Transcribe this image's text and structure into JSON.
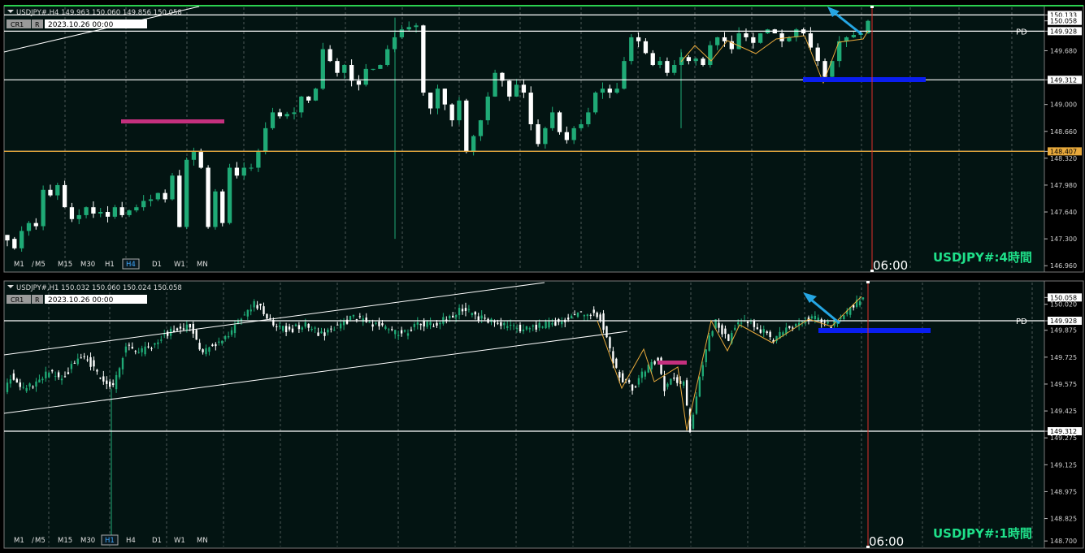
{
  "colors": {
    "bg": "#031412",
    "bull": "#1faa76",
    "bear": "#ffffff",
    "level": "#ffffff",
    "orange": "#e8a93c",
    "blue": "#0a1ef0",
    "pink": "#c4307e",
    "cyan": "#25a6e3",
    "vline": "#e0302a",
    "label": "#1fe08a"
  },
  "timeframes_top": [
    "M1",
    "M5",
    "M15",
    "M30",
    "H1",
    "H4",
    "D1",
    "W1",
    "MN"
  ],
  "timeframes_bottom": [
    "M1",
    "M5",
    "M15",
    "M30",
    "H1",
    "H4",
    "D1",
    "W1",
    "MN"
  ],
  "chart_data": [
    {
      "type": "candlestick",
      "symbol_line": "USDJPY#,H4  149.963 150.060 149.856 150.058",
      "badge_cr": "CR1",
      "badge_r": "R",
      "date": "2023.10.26 00:00",
      "watermark": "USDJPY#:4時間",
      "time_label": "06:00",
      "pd_label": "PD",
      "active_tf": "H4",
      "ylim": [
        146.88,
        150.25
      ],
      "yticks": [
        "150.133",
        "150.058",
        "149.928",
        "149.680",
        "149.312",
        "149.000",
        "148.660",
        "148.407",
        "148.320",
        "147.980",
        "147.640",
        "147.300",
        "146.960"
      ],
      "levels": [
        149.928,
        149.312,
        150.133,
        148.407
      ],
      "level_tags": [
        {
          "value": "150.133",
          "color": "white"
        },
        {
          "value": "150.058",
          "color": "white"
        },
        {
          "value": "149.928",
          "color": "white"
        },
        {
          "value": "149.312",
          "color": "white"
        },
        {
          "value": "148.407",
          "color": "orange"
        }
      ],
      "close_start": 147.28,
      "close_end": 150.058,
      "ohlc": [
        [
          147.35,
          147.28
        ],
        [
          147.3,
          147.18
        ],
        [
          147.18,
          147.4
        ],
        [
          147.4,
          147.5
        ],
        [
          147.5,
          147.46
        ],
        [
          147.46,
          147.92
        ],
        [
          147.92,
          147.85
        ],
        [
          147.85,
          147.98
        ],
        [
          147.98,
          147.7
        ],
        [
          147.7,
          147.55
        ],
        [
          147.55,
          147.6
        ],
        [
          147.6,
          147.7
        ],
        [
          147.7,
          147.62
        ],
        [
          147.62,
          147.64
        ],
        [
          147.64,
          147.58
        ],
        [
          147.58,
          147.7
        ],
        [
          147.7,
          147.6
        ],
        [
          147.6,
          147.66
        ],
        [
          147.66,
          147.7
        ],
        [
          147.7,
          147.78
        ],
        [
          147.78,
          147.8
        ],
        [
          147.8,
          147.88
        ],
        [
          147.88,
          147.8
        ],
        [
          147.8,
          148.1
        ],
        [
          148.1,
          147.45
        ],
        [
          147.45,
          148.3
        ],
        [
          148.3,
          148.4
        ],
        [
          148.4,
          148.2
        ],
        [
          148.2,
          147.45
        ],
        [
          147.45,
          147.9
        ],
        [
          147.9,
          147.5
        ],
        [
          147.5,
          148.2
        ],
        [
          148.2,
          148.1
        ],
        [
          148.1,
          148.2
        ],
        [
          148.2,
          148.2
        ],
        [
          148.2,
          148.4
        ],
        [
          148.4,
          148.7
        ],
        [
          148.7,
          148.9
        ],
        [
          148.9,
          148.85
        ],
        [
          148.85,
          148.88
        ],
        [
          148.88,
          148.9
        ],
        [
          148.9,
          149.1
        ],
        [
          149.1,
          149.05
        ],
        [
          149.05,
          149.2
        ],
        [
          149.2,
          149.7
        ],
        [
          149.7,
          149.55
        ],
        [
          149.55,
          149.4
        ],
        [
          149.4,
          149.5
        ],
        [
          149.5,
          149.3
        ],
        [
          149.3,
          149.25
        ],
        [
          149.25,
          149.45
        ],
        [
          149.45,
          149.45
        ],
        [
          149.45,
          149.5
        ],
        [
          149.5,
          149.7
        ],
        [
          149.7,
          149.85
        ],
        [
          149.85,
          149.95
        ],
        [
          149.95,
          149.98
        ],
        [
          149.98,
          150.0
        ],
        [
          150.0,
          149.15
        ],
        [
          149.15,
          148.95
        ],
        [
          148.95,
          149.2
        ],
        [
          149.2,
          149.0
        ],
        [
          149.0,
          148.8
        ],
        [
          148.8,
          149.05
        ],
        [
          149.05,
          148.4
        ],
        [
          148.4,
          148.6
        ],
        [
          148.6,
          148.8
        ],
        [
          148.8,
          149.1
        ],
        [
          149.1,
          149.4
        ],
        [
          149.4,
          149.3
        ],
        [
          149.3,
          149.1
        ],
        [
          149.1,
          149.25
        ],
        [
          149.25,
          149.15
        ],
        [
          149.15,
          148.75
        ],
        [
          148.75,
          148.5
        ],
        [
          148.5,
          148.7
        ],
        [
          148.7,
          148.9
        ],
        [
          148.9,
          148.65
        ],
        [
          148.65,
          148.55
        ],
        [
          148.55,
          148.7
        ],
        [
          148.7,
          148.75
        ],
        [
          148.75,
          148.9
        ],
        [
          148.9,
          149.15
        ],
        [
          149.15,
          149.2
        ],
        [
          149.2,
          149.15
        ],
        [
          149.15,
          149.2
        ],
        [
          149.2,
          149.55
        ],
        [
          149.55,
          149.85
        ],
        [
          149.85,
          149.8
        ],
        [
          149.8,
          149.65
        ],
        [
          149.65,
          149.5
        ],
        [
          149.5,
          149.55
        ],
        [
          149.55,
          149.4
        ],
        [
          149.4,
          149.5
        ],
        [
          149.5,
          149.6
        ],
        [
          149.6,
          149.55
        ],
        [
          149.55,
          149.58
        ],
        [
          149.58,
          149.5
        ],
        [
          149.5,
          149.75
        ],
        [
          149.75,
          149.85
        ],
        [
          149.85,
          149.8
        ],
        [
          149.8,
          149.7
        ],
        [
          149.7,
          149.9
        ],
        [
          149.9,
          149.85
        ],
        [
          149.85,
          149.78
        ],
        [
          149.78,
          149.9
        ],
        [
          149.9,
          149.95
        ],
        [
          149.95,
          149.9
        ],
        [
          149.9,
          149.8
        ],
        [
          149.8,
          149.85
        ],
        [
          149.85,
          149.95
        ],
        [
          149.95,
          149.9
        ],
        [
          149.9,
          149.72
        ],
        [
          149.72,
          149.55
        ],
        [
          149.55,
          149.35
        ],
        [
          149.35,
          149.55
        ],
        [
          149.55,
          149.8
        ],
        [
          149.8,
          149.85
        ],
        [
          149.85,
          149.88
        ],
        [
          149.88,
          149.9
        ],
        [
          149.9,
          150.058
        ]
      ]
    },
    {
      "type": "candlestick",
      "symbol_line": "USDJPY#,H1  150.032 150.060 150.024 150.058",
      "badge_cr": "CR1",
      "badge_r": "R",
      "date": "2023.10.26 00:00",
      "watermark": "USDJPY#:1時間",
      "time_label": "06:00",
      "pd_label": "PD",
      "active_tf": "H1",
      "ylim": [
        148.66,
        150.15
      ],
      "yticks": [
        "150.058",
        "150.020",
        "149.928",
        "149.875",
        "149.725",
        "149.575",
        "149.425",
        "149.312",
        "149.275",
        "149.125",
        "148.975",
        "148.825",
        "148.700"
      ],
      "levels": [
        149.928,
        149.312
      ],
      "level_tags": [
        {
          "value": "150.058",
          "color": "white"
        },
        {
          "value": "149.928",
          "color": "white"
        },
        {
          "value": "149.312",
          "color": "white"
        }
      ],
      "close_start": 149.55,
      "close_end": 150.058
    }
  ]
}
